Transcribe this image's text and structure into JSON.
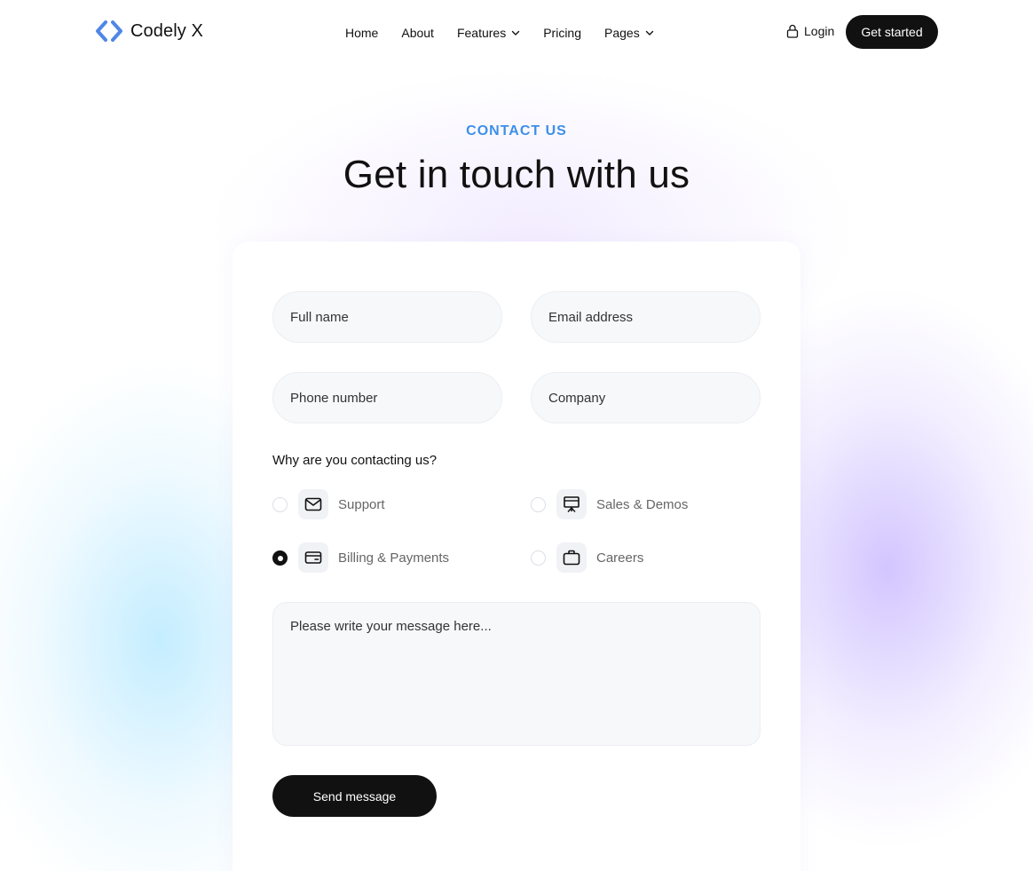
{
  "brand": {
    "name": "Codely X",
    "accent": "#4f86e8"
  },
  "nav": {
    "items": [
      {
        "label": "Home",
        "icon": null
      },
      {
        "label": "About",
        "icon": null
      },
      {
        "label": "Features",
        "icon": "chevron-down-icon"
      },
      {
        "label": "Pricing",
        "icon": null
      },
      {
        "label": "Pages",
        "icon": "chevron-down-icon"
      }
    ],
    "login_label": "Login",
    "cta_label": "Get started"
  },
  "hero": {
    "eyebrow": "CONTACT US",
    "eyebrow_color": "#3d8fe8",
    "title": "Get in touch with us"
  },
  "form": {
    "full_name_placeholder": "Full name",
    "email_placeholder": "Email address",
    "phone_placeholder": "Phone number",
    "company_placeholder": "Company",
    "question": "Why are you contacting us?",
    "options": [
      {
        "label": "Support",
        "icon": "mail-icon",
        "selected": false
      },
      {
        "label": "Sales & Demos",
        "icon": "presentation-icon",
        "selected": false
      },
      {
        "label": "Billing & Payments",
        "icon": "credit-card-icon",
        "selected": true
      },
      {
        "label": "Careers",
        "icon": "briefcase-icon",
        "selected": false
      }
    ],
    "message_placeholder": "Please write your message here...",
    "submit_label": "Send message"
  }
}
